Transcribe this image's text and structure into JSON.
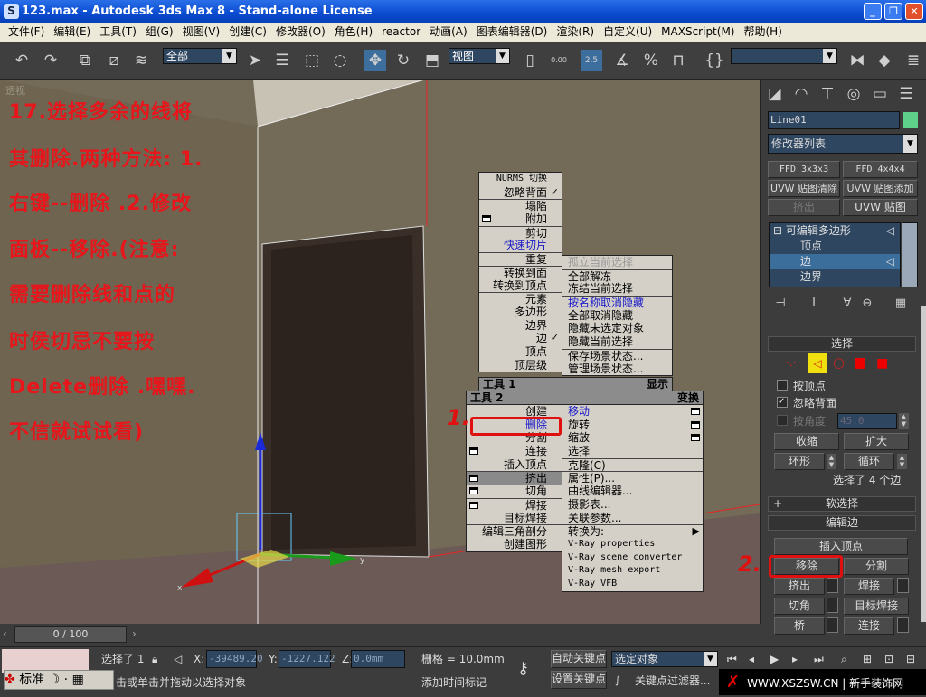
{
  "window": {
    "title": "123.max - Autodesk 3ds Max 8 - Stand-alone License",
    "app_icon": "S",
    "controls": [
      "_",
      "❐",
      "✕"
    ]
  },
  "menu": [
    "文件(F)",
    "编辑(E)",
    "工具(T)",
    "组(G)",
    "视图(V)",
    "创建(C)",
    "修改器(O)",
    "角色(H)",
    "reactor",
    "动画(A)",
    "图表编辑器(D)",
    "渲染(R)",
    "自定义(U)",
    "MAXScript(M)",
    "帮助(H)"
  ],
  "toolbar": {
    "selection_filter": "全部",
    "reference_coord": "视图",
    "snap_value": "2.5",
    "angle_value": "0.00",
    "named_selection": ""
  },
  "viewport": {
    "label": "透视",
    "axis_y": "y",
    "axis_x": "x"
  },
  "annotation": {
    "lines": [
      "17.选择多余的线将",
      "其删除.两种方法: 1.",
      "右键--删除 .2.修改",
      "面板--移除.(注意:",
      "需要删除线和点的",
      "时侯切忌不要按",
      "Delete删除 .嘿嘿.",
      "不信就试试看)"
    ],
    "marker1": "1.",
    "marker2": "2."
  },
  "quad_menu": {
    "upper_left": [
      "NURMS 切换",
      "忽略背面",
      "塌陷",
      "附加",
      "剪切",
      "快速切片",
      "重复",
      "转换到面",
      "转换到顶点",
      "元素",
      "多边形",
      "边界",
      "边",
      "顶点",
      "顶层级"
    ],
    "upper_right": [
      "孤立当前选择",
      "全部解冻",
      "冻结当前选择",
      "按名称取消隐藏",
      "全部取消隐藏",
      "隐藏未选定对象",
      "隐藏当前选择",
      "保存场景状态...",
      "管理场景状态..."
    ],
    "tools1_label": "工具 1",
    "display_label": "显示",
    "tools2_label": "工具 2",
    "transform_label": "变换",
    "lower_left": [
      "创建",
      "删除",
      "分割",
      "连接",
      "插入顶点",
      "挤出",
      "切角",
      "焊接",
      "目标焊接",
      "编辑三角剖分",
      "创建图形"
    ],
    "lower_right": [
      "移动",
      "旋转",
      "缩放",
      "选择",
      "克隆(C)",
      "属性(P)...",
      "曲线编辑器...",
      "摄影表...",
      "关联参数...",
      "转换为:",
      "V-Ray properties",
      "V-Ray scene converter",
      "V-Ray mesh export",
      "V-Ray VFB"
    ]
  },
  "panel": {
    "object_name": "Line01",
    "object_color": "#5fd08a",
    "modifier_list": "修改器列表",
    "modifier_buttons": [
      "FFD 3x3x3",
      "FFD 4x4x4",
      "UVW 贴图清除",
      "UVW 贴图添加",
      "挤出",
      "UVW 贴图"
    ],
    "stack": [
      "可编辑多边形",
      "顶点",
      "边",
      "边界"
    ],
    "selection": {
      "title": "选择",
      "by_vertex": "按顶点",
      "ignore_backfacing": "忽略背面",
      "by_angle": "按角度",
      "angle_value": "45.0",
      "shrink": "收缩",
      "grow": "扩大",
      "ring": "环形",
      "loop": "循环",
      "status": "选择了 4 个边"
    },
    "soft_selection": "软选择",
    "edit_edges": {
      "title": "编辑边",
      "insert_vertex": "插入顶点",
      "remove": "移除",
      "split": "分割",
      "extrude": "挤出",
      "weld": "焊接",
      "chamfer": "切角",
      "target_weld": "目标焊接",
      "bridge": "桥",
      "connect": "连接"
    }
  },
  "timeline": {
    "frame": "0 / 100"
  },
  "status": {
    "selected": "选择了 1",
    "x": "-39489.20",
    "y": "-1227.122",
    "z": "0.0mm",
    "grid": "栅格 = 10.0mm",
    "auto_key": "自动关键点",
    "set_key": "设置关键点",
    "key_mode": "选定对象",
    "key_filters": "关键点过滤器...",
    "add_time_tag": "添加时间标记",
    "prompt": "击或单击并拖动以选择对象",
    "ime": "标准",
    "watermark": "WWW.XSZSW.CN",
    "watermark2": "新手装饰网"
  }
}
